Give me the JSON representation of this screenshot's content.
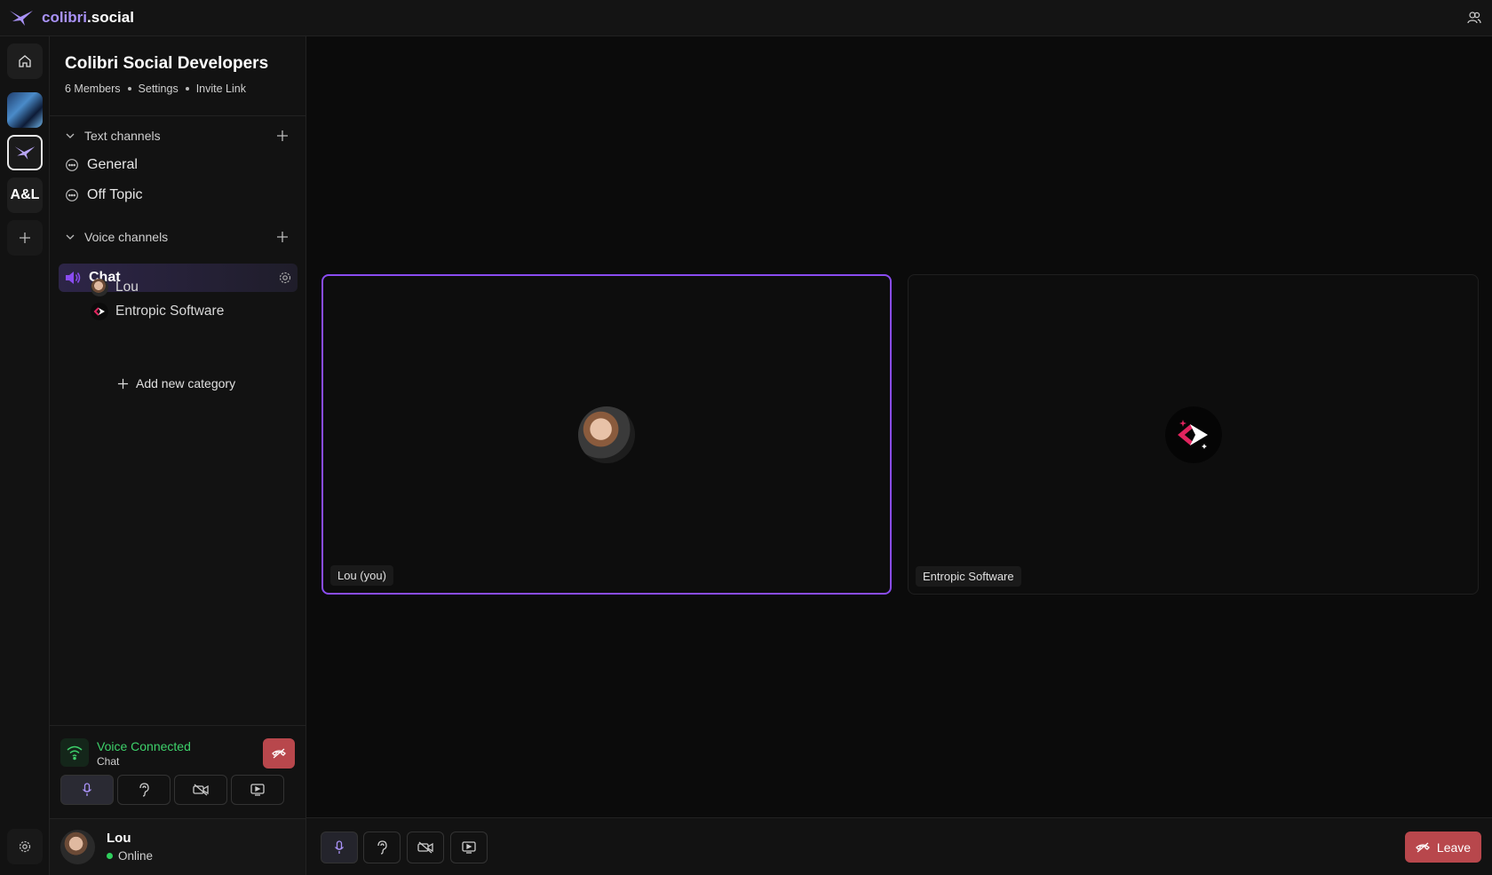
{
  "app": {
    "brand_part1": "colibri",
    "brand_part2": ".social",
    "accent": "#8a4cf0"
  },
  "rail": {
    "server3_label": "A&L"
  },
  "server": {
    "title": "Colibri Social Developers",
    "members": "6 Members",
    "settings": "Settings",
    "invite": "Invite Link"
  },
  "text_category": {
    "label": "Text channels",
    "channels": [
      "General",
      "Off Topic"
    ]
  },
  "voice_category": {
    "label": "Voice channels",
    "active_channel": "Chat",
    "members": [
      "Lou",
      "Entropic Software"
    ]
  },
  "add_category_label": "Add new category",
  "voice_status": {
    "title": "Voice Connected",
    "channel": "Chat"
  },
  "user": {
    "name": "Lou",
    "status": "Online"
  },
  "tiles": {
    "you_label": "Lou (you)",
    "other_label": "Entropic Software"
  },
  "leave_label": "Leave"
}
